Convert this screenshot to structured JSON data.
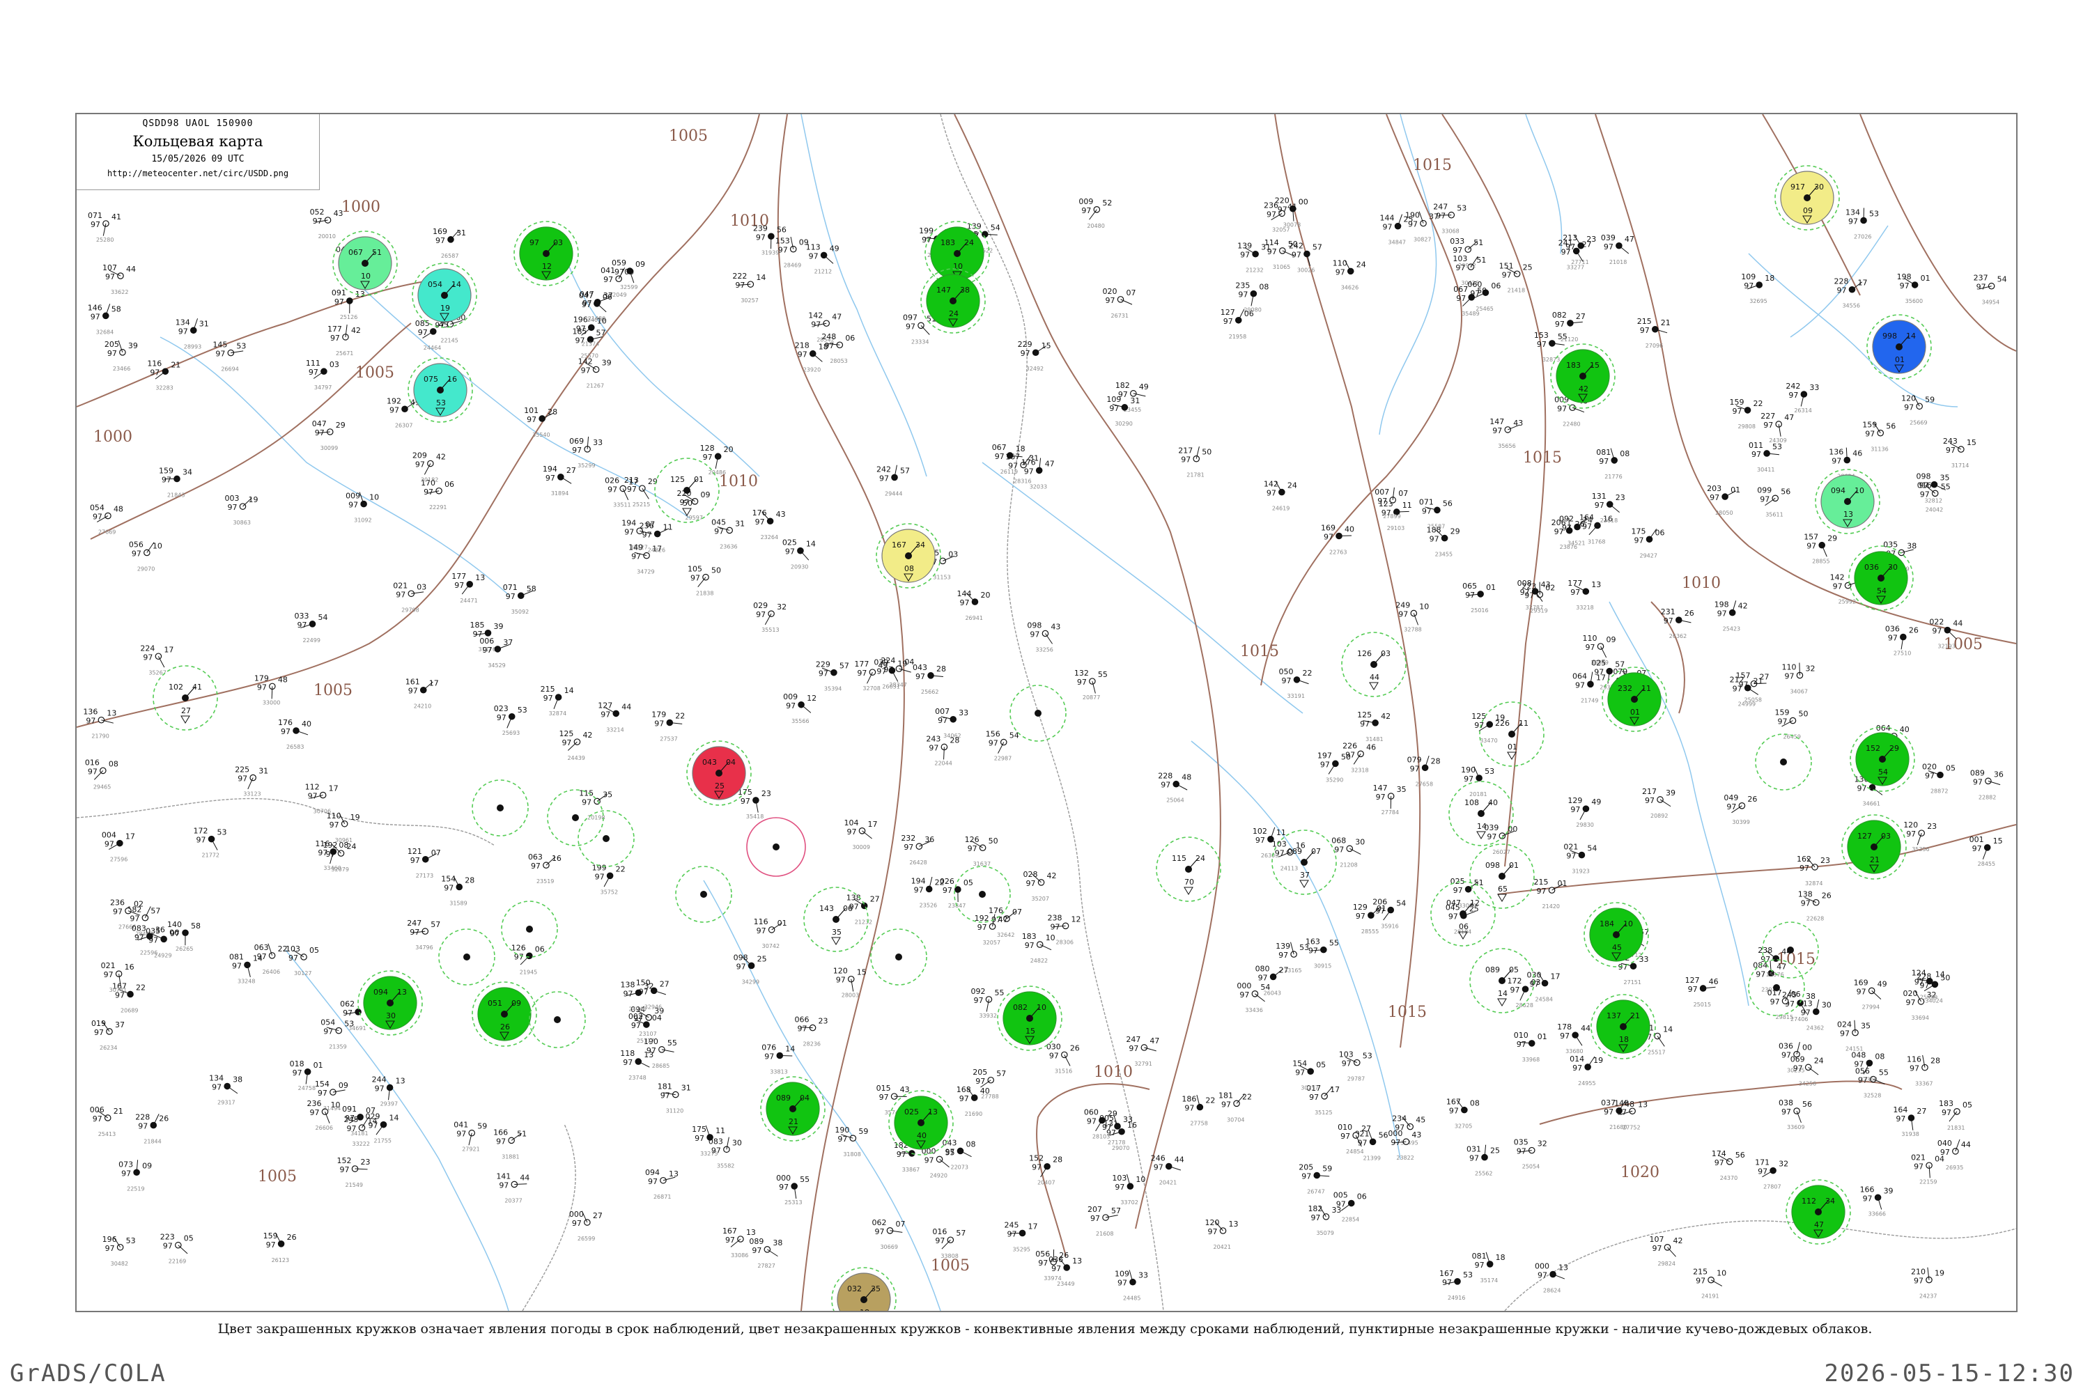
{
  "title_box": {
    "codes": "QSDD98  UAOL  150900",
    "name": "Кольцевая карта",
    "date": "15/05/2026 09 UTC",
    "url": "http://meteocenter.net/circ/USDD.png"
  },
  "caption": "Цвет закрашенных кружков означает явления погоды в срок наблюдений, цвет незакрашенных кружков - конвективные явления между сроками наблюдений, пунктирные незакрашенные кружки - наличие кучево-дождевых облаков.",
  "footer": {
    "left": "GrADS/COLA",
    "right": "2026-05-15-12:30"
  },
  "colors": {
    "isobar": "#a07060",
    "river": "#8fc8ee",
    "border": "#888888",
    "rain": "#11c411",
    "rain_dashed": "#55cc55",
    "drizzle": "#66ee99",
    "snow_cyan": "#44e8cc",
    "blue": "#2266ee",
    "yellow": "#f2ec88",
    "red": "#e8304a",
    "olive": "#b8a060",
    "thunder_circle": "#e05080"
  },
  "isobar_labels": [
    "1000",
    "1000",
    "1005",
    "1005",
    "1005",
    "1005",
    "1005",
    "1005",
    "1010",
    "1010",
    "1010",
    "1010",
    "1015",
    "1015",
    "1015",
    "1015",
    "1015",
    "1020"
  ],
  "stations": [
    {
      "t": "102",
      "p": "41",
      "code": "27",
      "fill": "none"
    },
    {
      "t": "97",
      "p": "03",
      "code": "12",
      "fill": "rain"
    },
    {
      "t": "125",
      "p": "01",
      "code": "50",
      "fill": "none"
    },
    {
      "t": "143",
      "p": "06",
      "code": "35",
      "fill": "none"
    },
    {
      "t": "089",
      "p": "04",
      "code": "21",
      "fill": "rain"
    },
    {
      "t": "067",
      "p": "51",
      "code": "10",
      "fill": "drizzle"
    },
    {
      "t": "054",
      "p": "14",
      "code": "19",
      "fill": "snow"
    },
    {
      "t": "075",
      "p": "16",
      "code": "53",
      "fill": "snow"
    },
    {
      "t": "098",
      "p": "01",
      "code": "65",
      "fill": "none"
    },
    {
      "t": "183",
      "p": "24",
      "code": "10",
      "fill": "rain"
    },
    {
      "t": "147",
      "p": "38",
      "code": "24",
      "fill": "rain"
    },
    {
      "t": "025",
      "p": "13",
      "code": "40",
      "fill": "rain"
    },
    {
      "t": "051",
      "p": "09",
      "code": "26",
      "fill": "rain"
    },
    {
      "t": "094",
      "p": "13",
      "code": "30",
      "fill": "rain"
    },
    {
      "t": "082",
      "p": "10",
      "code": "15",
      "fill": "rain"
    },
    {
      "t": "167",
      "p": "34",
      "code": "08",
      "fill": "yellow"
    },
    {
      "t": "043",
      "p": "04",
      "code": "25",
      "fill": "red"
    },
    {
      "t": "917",
      "p": "30",
      "code": "09",
      "fill": "yellow"
    },
    {
      "t": "998",
      "p": "14",
      "code": "01",
      "fill": "blue"
    },
    {
      "t": "094",
      "p": "10",
      "code": "13",
      "fill": "drizzle"
    },
    {
      "t": "036",
      "p": "30",
      "code": "54",
      "fill": "rain"
    },
    {
      "t": "183",
      "p": "15",
      "code": "42",
      "fill": "rain"
    },
    {
      "t": "232",
      "p": "11",
      "code": "01",
      "fill": "rain"
    },
    {
      "t": "032",
      "p": "35",
      "code": "18",
      "fill": "olive"
    },
    {
      "t": "152",
      "p": "29",
      "code": "54",
      "fill": "rain"
    },
    {
      "t": "127",
      "p": "03",
      "code": "21",
      "fill": "rain"
    },
    {
      "t": "184",
      "p": "10",
      "code": "45",
      "fill": "rain"
    },
    {
      "t": "137",
      "p": "21",
      "code": "18",
      "fill": "rain"
    },
    {
      "t": "112",
      "p": "34",
      "code": "47",
      "fill": "rain"
    },
    {
      "t": "089",
      "p": "05",
      "code": "14",
      "fill": "none"
    },
    {
      "t": "108",
      "p": "40",
      "code": "14",
      "fill": "none"
    },
    {
      "t": "047",
      "p": "12",
      "code": "06",
      "fill": "none"
    },
    {
      "t": "126",
      "p": "03",
      "code": "44",
      "fill": "none"
    },
    {
      "t": "115",
      "p": "24",
      "code": "70",
      "fill": "none"
    },
    {
      "t": "089",
      "p": "07",
      "code": "37",
      "fill": "none"
    },
    {
      "t": "226",
      "p": "11",
      "code": "01",
      "fill": "none"
    }
  ]
}
